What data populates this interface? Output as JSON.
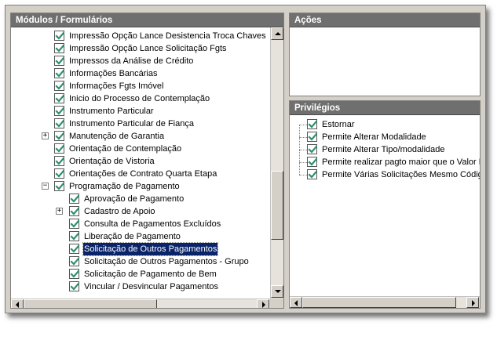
{
  "modulos": {
    "title": "Módulos / Formulários",
    "items": [
      {
        "label": "Impressão Opção Lance Desistencia Troca Chaves",
        "level": 1,
        "expander": ""
      },
      {
        "label": "Impressão Opção Lance Solicitação Fgts",
        "level": 1,
        "expander": ""
      },
      {
        "label": "Impressos da Análise de Crédito",
        "level": 1,
        "expander": ""
      },
      {
        "label": "Informações Bancárias",
        "level": 1,
        "expander": ""
      },
      {
        "label": "Informações Fgts Imóvel",
        "level": 1,
        "expander": ""
      },
      {
        "label": "Inicio do Processo de Contemplação",
        "level": 1,
        "expander": ""
      },
      {
        "label": "Instrumento Particular",
        "level": 1,
        "expander": ""
      },
      {
        "label": "Instrumento Particular de Fiança",
        "level": 1,
        "expander": ""
      },
      {
        "label": "Manutenção de Garantia",
        "level": 1,
        "expander": "+"
      },
      {
        "label": "Orientação de Contemplação",
        "level": 1,
        "expander": ""
      },
      {
        "label": "Orientação de Vistoria",
        "level": 1,
        "expander": ""
      },
      {
        "label": "Orientações de Contrato Quarta Etapa",
        "level": 1,
        "expander": ""
      },
      {
        "label": "Programação de Pagamento",
        "level": 1,
        "expander": "−"
      },
      {
        "label": "Aprovação de Pagamento",
        "level": 2,
        "expander": ""
      },
      {
        "label": "Cadastro de Apoio",
        "level": 2,
        "expander": "+"
      },
      {
        "label": "Consulta de Pagamentos Excluídos",
        "level": 2,
        "expander": ""
      },
      {
        "label": "Liberação de Pagamento",
        "level": 2,
        "expander": ""
      },
      {
        "label": "Solicitação de Outros Pagamentos",
        "level": 2,
        "expander": "",
        "selected": true
      },
      {
        "label": "Solicitação de Outros Pagamentos - Grupo",
        "level": 2,
        "expander": ""
      },
      {
        "label": "Solicitação de Pagamento de Bem",
        "level": 2,
        "expander": ""
      },
      {
        "label": "Vincular / Desvincular Pagamentos",
        "level": 2,
        "expander": ""
      }
    ]
  },
  "acoes": {
    "title": "Ações"
  },
  "privilegios": {
    "title": "Privilégios",
    "items": [
      {
        "label": "Estornar"
      },
      {
        "label": "Permite Alterar Modalidade"
      },
      {
        "label": "Permite Alterar Tipo/modalidade"
      },
      {
        "label": "Permite realizar pagto maior que o Valor D"
      },
      {
        "label": "Permite Várias Solicitações Mesmo Códig"
      }
    ]
  },
  "colors": {
    "header_bg": "#6f6f6f",
    "selection_bg": "#0a246a",
    "check_color": "#2f8f6f"
  }
}
